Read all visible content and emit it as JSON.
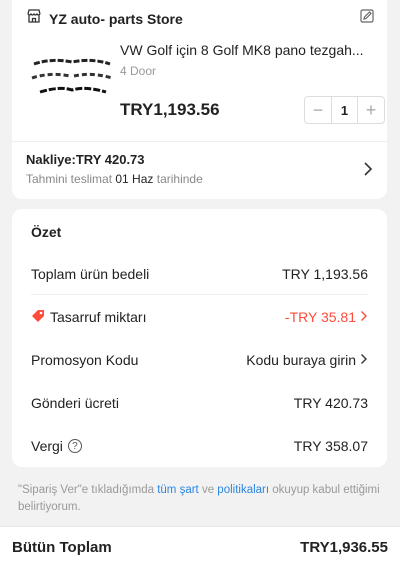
{
  "store": {
    "name": "YZ auto- parts Store",
    "icon": "store-icon"
  },
  "product": {
    "title": "VW Golf için 8 Golf MK8 pano tezgah...",
    "variant": "4 Door",
    "price": "TRY1,193.56",
    "quantity": "1"
  },
  "shipping": {
    "label": "Nakliye:TRY 420.73",
    "delivery_prefix": "Tahmini teslimat ",
    "delivery_date": "01 Haz",
    "delivery_suffix": " tarihinde"
  },
  "summary": {
    "title": "Özet",
    "subtotal_label": "Toplam ürün bedeli",
    "subtotal_value": "TRY 1,193.56",
    "savings_label": "Tasarruf miktarı",
    "savings_value": "-TRY 35.81",
    "promo_label": "Promosyon Kodu",
    "promo_value": "Kodu buraya girin",
    "shipping_label": "Gönderi ücreti",
    "shipping_value": "TRY 420.73",
    "tax_label": "Vergi",
    "tax_help": "?",
    "tax_value": "TRY 358.07"
  },
  "terms": {
    "prefix": "\"Sipariş Ver\"e tıkladığımda ",
    "link1": "tüm şart",
    "middle": " ve ",
    "link2": "politikaları",
    "suffix": " okuyup kabul ettiğimi belirtiyorum."
  },
  "total": {
    "label": "Bütün Toplam",
    "value": "TRY1,936.55"
  },
  "colors": {
    "accent_red": "#fe4c3a",
    "link_blue": "#2b86e4"
  }
}
